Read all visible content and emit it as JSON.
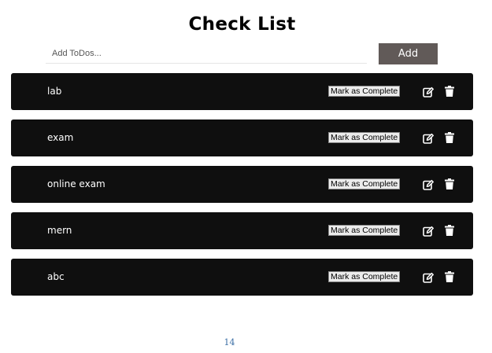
{
  "header": {
    "title": "Check List"
  },
  "add_form": {
    "placeholder": "Add ToDos...",
    "value": "",
    "add_label": "Add"
  },
  "todos": [
    {
      "text": "lab",
      "complete_label": "Mark as Complete",
      "edit_icon": "edit-icon",
      "delete_icon": "trash-icon"
    },
    {
      "text": "exam",
      "complete_label": "Mark as Complete",
      "edit_icon": "edit-icon",
      "delete_icon": "trash-icon"
    },
    {
      "text": "online exam",
      "complete_label": "Mark as Complete",
      "edit_icon": "edit-icon",
      "delete_icon": "trash-icon"
    },
    {
      "text": "mern",
      "complete_label": "Mark as Complete",
      "edit_icon": "edit-icon",
      "delete_icon": "trash-icon"
    },
    {
      "text": "abc",
      "complete_label": "Mark as Complete",
      "edit_icon": "edit-icon",
      "delete_icon": "trash-icon"
    }
  ],
  "footer": {
    "page_number": "14"
  },
  "colors": {
    "row_background": "#0f0f0f",
    "add_button_background": "#615a58",
    "page_number_color": "#3a6ea5"
  }
}
